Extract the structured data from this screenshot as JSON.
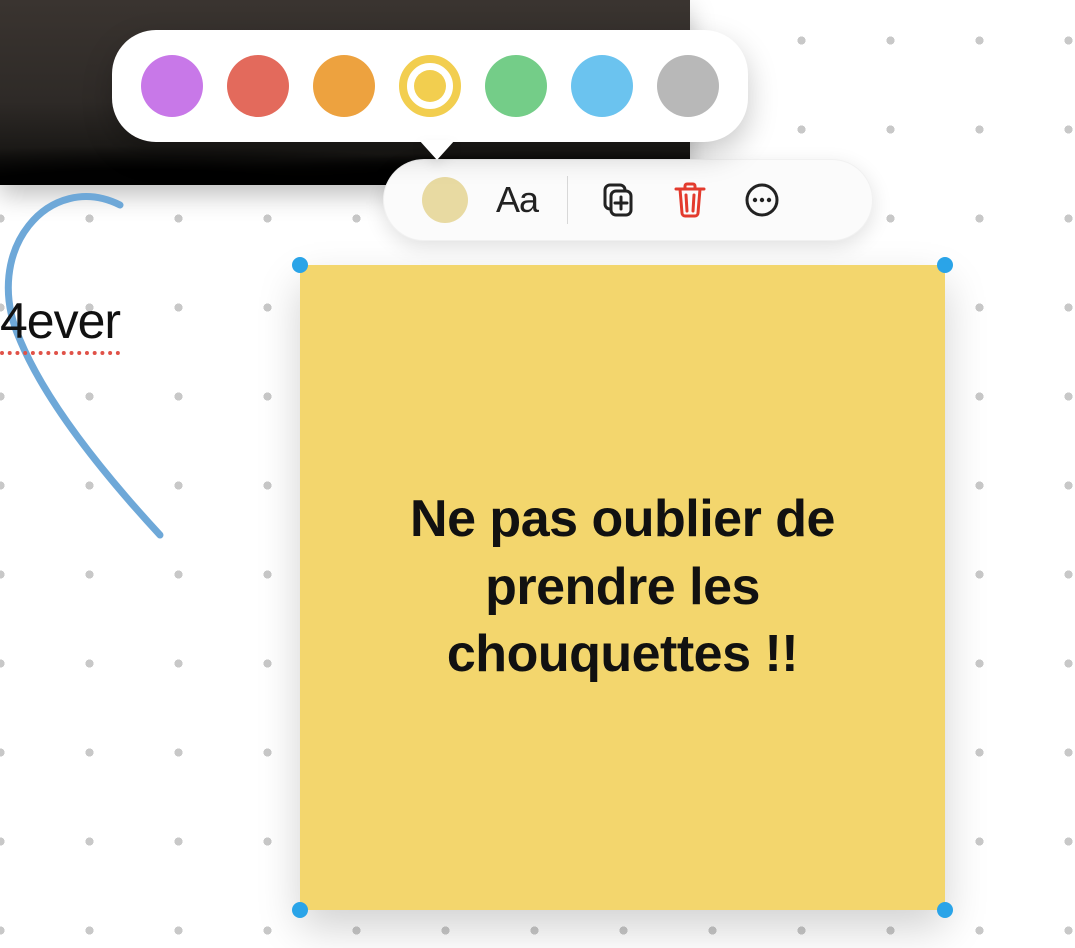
{
  "canvas": {
    "stray_text_partial": "4ever",
    "sticky_note_text": "Ne pas oublier de prendre les chouquettes !!"
  },
  "toolbar": {
    "text_style_label": "Aa",
    "current_color": "#e8daa2"
  },
  "color_popover": {
    "selected_index": 3,
    "swatches": [
      {
        "name": "purple",
        "hex": "#c878e8"
      },
      {
        "name": "red",
        "hex": "#e36a5c"
      },
      {
        "name": "orange",
        "hex": "#eda23f"
      },
      {
        "name": "yellow",
        "hex": "#f2ce4f"
      },
      {
        "name": "green",
        "hex": "#74cd88"
      },
      {
        "name": "blue",
        "hex": "#6bc3ef"
      },
      {
        "name": "gray",
        "hex": "#b8b8b8"
      }
    ]
  }
}
